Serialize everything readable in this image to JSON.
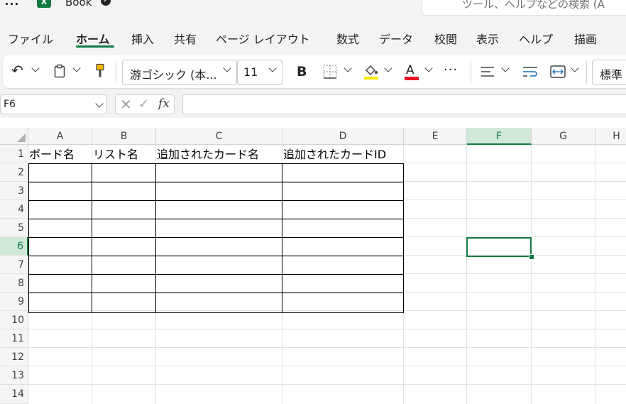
{
  "titlebar": {
    "book_title": "Book",
    "search_placeholder": "ツール、ヘルプなどの検索 (A"
  },
  "ribbon_tabs": [
    "ファイル",
    "ホーム",
    "挿入",
    "共有",
    "ページ レイアウト",
    "数式",
    "データ",
    "校閲",
    "表示",
    "ヘルプ",
    "描画"
  ],
  "active_tab": "ホーム",
  "toolbar": {
    "font_name": "游ゴシック (本...",
    "font_size": "11",
    "bold_label": "B",
    "font_color_label": "A",
    "more_label": "···",
    "number_format": "標準",
    "font_color": "#e81123",
    "highlight_color": "#ffeb00"
  },
  "formula_bar": {
    "name_box": "F6",
    "cancel_glyph": "✕",
    "enter_glyph": "✓",
    "fx_label": "fx",
    "formula": ""
  },
  "sheet": {
    "columns": [
      "A",
      "B",
      "C",
      "D",
      "E",
      "F",
      "G",
      "H"
    ],
    "selected_column": "F",
    "rows": [
      "1",
      "2",
      "3",
      "4",
      "5",
      "6",
      "7",
      "8",
      "9",
      "10",
      "11",
      "12",
      "13",
      "14"
    ],
    "selected_row": "6",
    "header_cells": [
      "ボード名",
      "リスト名",
      "追加されたカード名",
      "追加されたカードID"
    ],
    "active_cell": "F6"
  },
  "colors": {
    "accent": "#107c41",
    "selected_header_bg": "#cfe8d8",
    "gridline": "#e1e1e1",
    "table_border": "#000000"
  }
}
